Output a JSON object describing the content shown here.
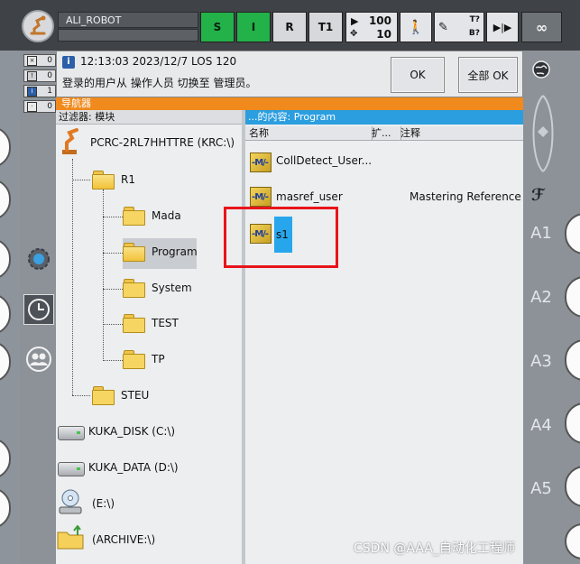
{
  "status_bar": {
    "robot_name": "ALI_ROBOT",
    "submit_state": "S",
    "drive_state": "I",
    "run_mode": "R",
    "operating_mode": "T1",
    "program_override": "100",
    "jog_override": "10",
    "tool_top": "T?",
    "tool_bottom": "B?",
    "increment": "∞"
  },
  "messages": {
    "counts": [
      "0",
      "0",
      "1",
      "0"
    ],
    "time_line": "12:13:03 2023/12/7 LOS 120",
    "text": "登录的用户从 操作人员 切换至 管理员。",
    "ok_label": "OK",
    "all_ok_label": "全部 OK"
  },
  "navigator": {
    "title": "导航器",
    "filter_label": "过滤器: 模块",
    "content_header": "...的内容: Program",
    "columns": [
      "名称",
      "扩...",
      "注释"
    ],
    "tree": {
      "root": "PCRC-2RL7HHTTRE (KRC:\\)",
      "r1": "R1",
      "r1_children": [
        "Mada",
        "Program",
        "System",
        "TEST",
        "TP"
      ],
      "steu": "STEU",
      "drives": [
        "KUKA_DISK (C:\\)",
        "KUKA_DATA (D:\\)",
        "(E:\\)",
        "(ARCHIVE:\\)"
      ]
    },
    "files": [
      {
        "name": "CollDetect_User...",
        "comment": ""
      },
      {
        "name": "masref_user",
        "comment": "Mastering Reference U..."
      },
      {
        "name": "s1",
        "comment": ""
      }
    ]
  },
  "axes": [
    "A1",
    "A2",
    "A3",
    "A4",
    "A5"
  ],
  "watermark": "CSDN @AAA_自动化工程师"
}
